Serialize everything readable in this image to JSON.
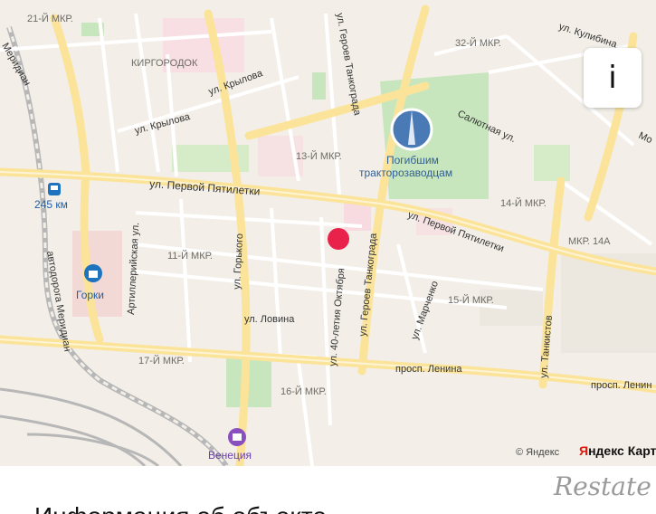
{
  "map": {
    "info_button_label": "i",
    "copyright": "© Яндекс",
    "brand_first": "Я",
    "brand_rest": "ндекс Карт",
    "marker_color": "#e8224b",
    "labels": {
      "mkr21": "21-Й МКР.",
      "mkr32": "32-Й МКР.",
      "kulibin": "ул. Кулибина",
      "kirgorodok": "КИРГОРОДОК",
      "krylova1": "ул. Крылова",
      "krylova2": "ул. Крылова",
      "geroev_top": "ул. Героев Танкограда",
      "meridian_top": "Меридиан",
      "salyutnaya": "Салютная ул.",
      "mo": "Мо",
      "mkr13": "13-Й МКР.",
      "poi_monument_1": "Погибшим",
      "poi_monument_2": "тракторозаводцам",
      "pervoy1": "ул. Первой Пятилетки",
      "km245": "245 км",
      "mkr14": "14-Й МКР.",
      "artilleriyskaya": "Артиллерийская ул.",
      "mkr11": "11-Й МКР.",
      "pervoy2": "ул. Первой Пятилетки",
      "mkr14a": "МКР. 14А",
      "gorkogo": "ул. Горького",
      "oktyabrya": "ул. 40-летия Октября",
      "geroev_mid": "ул. Героев Танкограда",
      "marchenko": "ул. Марченко",
      "mkr15": "15-Й МКР.",
      "tankistov": "ул. Танкистов",
      "gorki": "Горки",
      "avtodoroga": "автодорога Меридиан",
      "lovina": "ул. Ловина",
      "mkr17": "17-Й МКР.",
      "lenina1": "просп. Ленина",
      "lenina2": "просп. Ленин",
      "mkr16": "16-Й МКР.",
      "venetsiya": "Венеция"
    }
  },
  "footer": {
    "text": "Информация об объекте",
    "watermark": "Restate"
  }
}
